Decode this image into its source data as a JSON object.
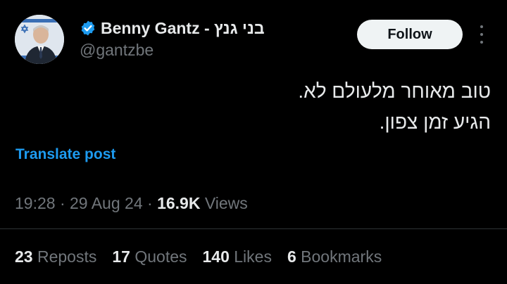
{
  "author": {
    "display_name": "Benny Gantz - בני גנץ",
    "handle": "@gantzbe",
    "verified_icon": "verified-badge-icon",
    "avatar_icon": "avatar-photo"
  },
  "actions": {
    "follow_label": "Follow",
    "more_icon": "more-options-icon"
  },
  "post": {
    "lines": [
      "טוב מאוחר מלעולם לא.",
      "הגיע זמן צפון."
    ],
    "translate_label": "Translate post"
  },
  "meta": {
    "time": "19:28",
    "date": "29 Aug 24",
    "views_count": "16.9K",
    "views_label": "Views",
    "separator": "·"
  },
  "stats": [
    {
      "count": "23",
      "label": "Reposts"
    },
    {
      "count": "17",
      "label": "Quotes"
    },
    {
      "count": "140",
      "label": "Likes"
    },
    {
      "count": "6",
      "label": "Bookmarks"
    }
  ],
  "colors": {
    "background": "#000000",
    "text": "#e7e9ea",
    "secondary": "#71767b",
    "link": "#1d9bf0",
    "divider": "#2f3336",
    "verified": "#1d9bf0"
  }
}
